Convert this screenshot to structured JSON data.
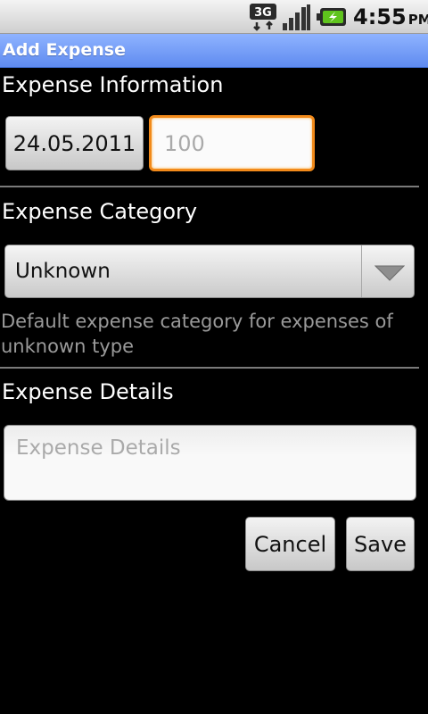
{
  "status_bar": {
    "network_label": "3G",
    "clock_time": "4:55",
    "clock_ampm": "PM",
    "icons": [
      "3g-data-icon",
      "signal-strength-icon",
      "battery-charging-icon"
    ]
  },
  "title_bar": {
    "title": "Add Expense"
  },
  "expense_information": {
    "label": "Expense Information",
    "date_value": "24.05.2011",
    "amount_placeholder": "100"
  },
  "expense_category": {
    "label": "Expense Category",
    "selected_value": "Unknown",
    "description": "Default expense category for expenses of unknown type"
  },
  "expense_details": {
    "label": "Expense Details",
    "placeholder": "Expense Details"
  },
  "actions": {
    "cancel_label": "Cancel",
    "save_label": "Save"
  },
  "colors": {
    "title_bar": "#6f9af5",
    "focus_border": "#f28a1a",
    "background": "#000000"
  }
}
